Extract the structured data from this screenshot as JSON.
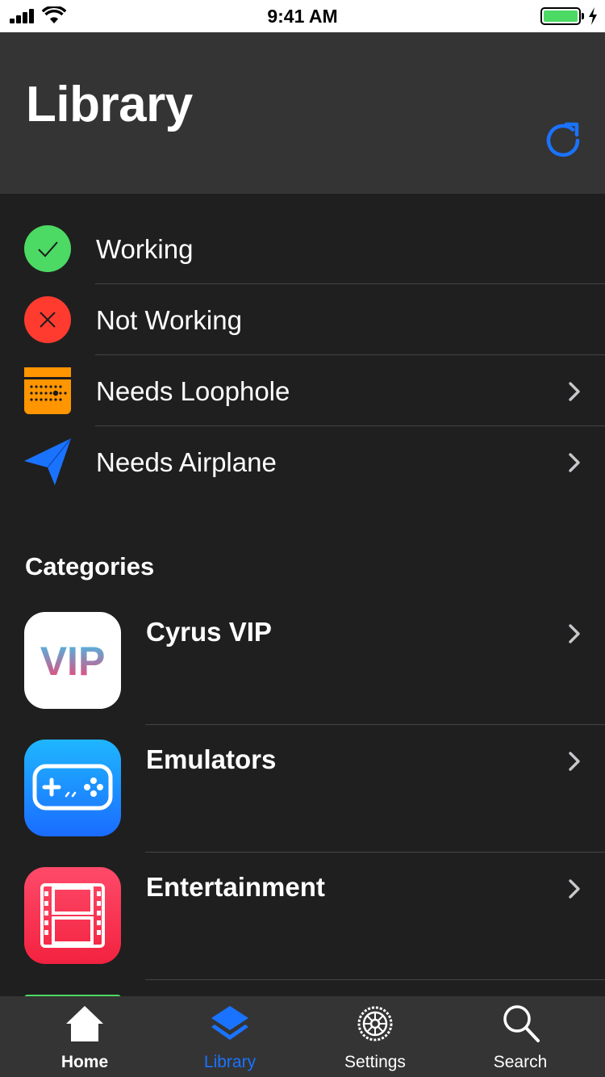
{
  "status_bar": {
    "time": "9:41 AM",
    "battery_level": 1.0,
    "icons": [
      "signal-icon",
      "wifi-icon",
      "battery-icon",
      "charging-bolt-icon"
    ]
  },
  "header": {
    "title": "Library",
    "refresh_icon": "refresh-icon"
  },
  "status_list": [
    {
      "label": "Working",
      "icon": "checkmark-icon",
      "color": "#4cd964",
      "has_chevron": false
    },
    {
      "label": "Not Working",
      "icon": "x-mark-icon",
      "color": "#ff3b30",
      "has_chevron": false
    },
    {
      "label": "Needs Loophole",
      "icon": "loophole-icon",
      "color": "#ff9500",
      "has_chevron": true
    },
    {
      "label": "Needs Airplane",
      "icon": "airplane-icon",
      "color": "#1a73ff",
      "has_chevron": true
    }
  ],
  "categories": {
    "title": "Categories",
    "items": [
      {
        "label": "Cyrus VIP",
        "icon_text": "VIP",
        "icon": "vip-icon"
      },
      {
        "label": "Emulators",
        "icon": "gamepad-icon"
      },
      {
        "label": "Entertainment",
        "icon": "film-strip-icon"
      }
    ]
  },
  "tab_bar": {
    "items": [
      {
        "label": "Home",
        "icon": "home-icon",
        "active": false
      },
      {
        "label": "Library",
        "icon": "layers-icon",
        "active": true
      },
      {
        "label": "Settings",
        "icon": "gear-icon",
        "active": false
      },
      {
        "label": "Search",
        "icon": "search-icon",
        "active": false
      }
    ]
  },
  "colors": {
    "accent": "#1a73ff",
    "background": "#1f1f1f",
    "header_background": "#343434",
    "text": "#ffffff"
  }
}
